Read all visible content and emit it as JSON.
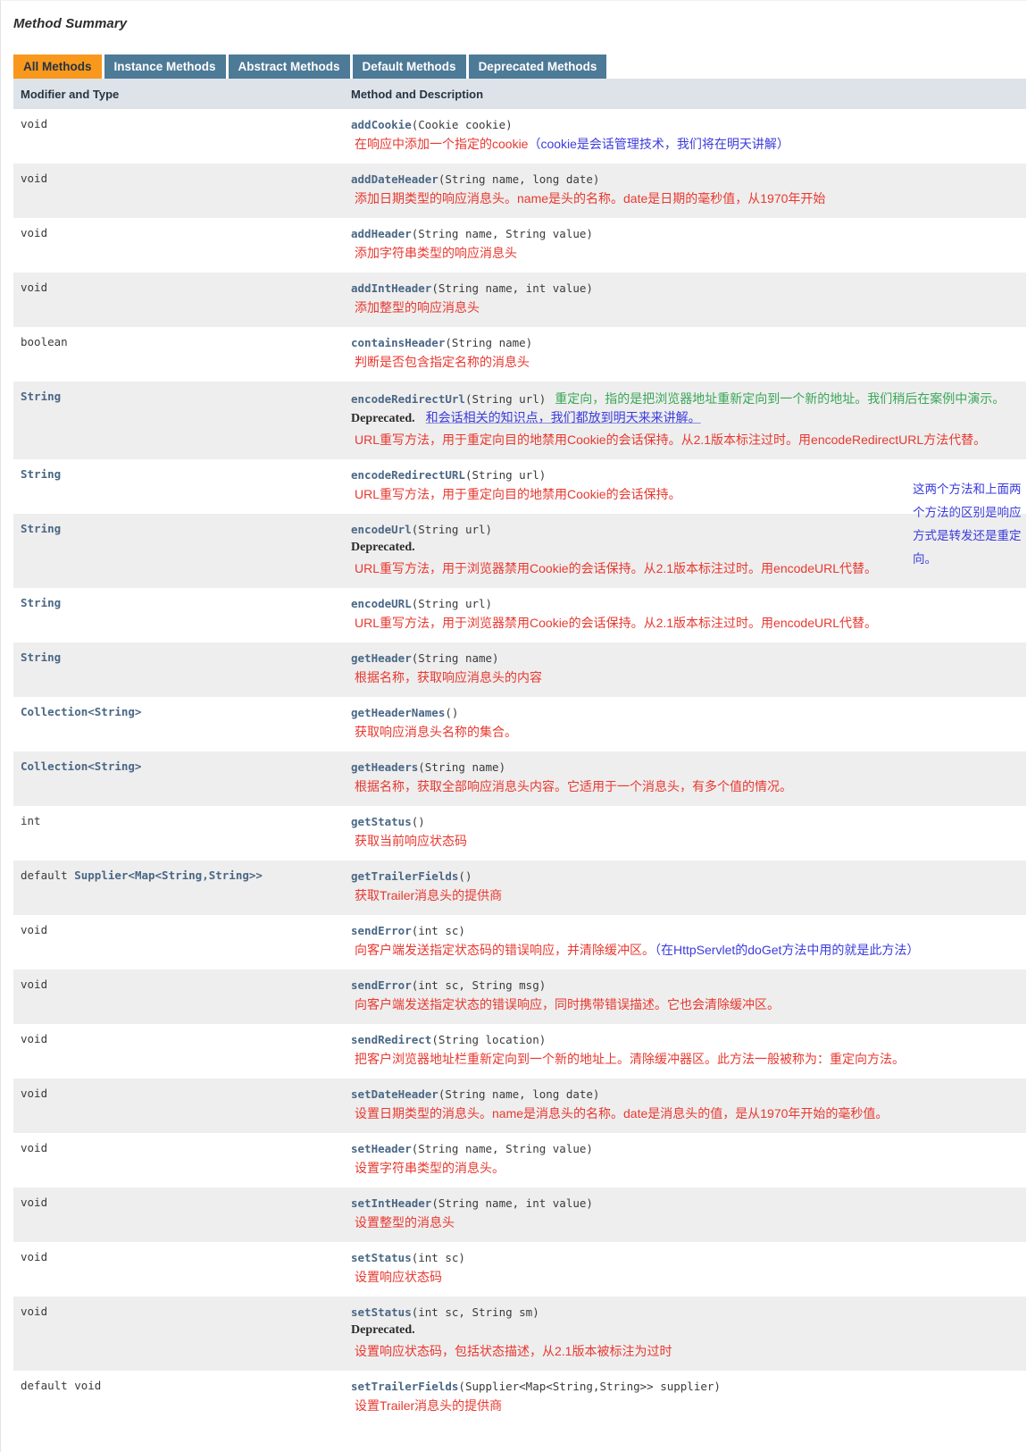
{
  "section": {
    "title": "Method Summary"
  },
  "tabs": [
    {
      "label": "All Methods",
      "active": true
    },
    {
      "label": "Instance Methods",
      "active": false
    },
    {
      "label": "Abstract Methods",
      "active": false
    },
    {
      "label": "Default Methods",
      "active": false
    },
    {
      "label": "Deprecated Methods",
      "active": false
    }
  ],
  "columns": {
    "modifier": "Modifier and Type",
    "method": "Method and Description"
  },
  "side_note": {
    "text": "这两个方法和上面两个方法的区别是响应方式是转发还是重定向。"
  },
  "colors": {
    "tab_active": "#f8981d",
    "tab_inactive": "#4d7a97",
    "header_bg": "#dee3e9",
    "row_alt_bg": "#eeeeee",
    "link": "#4a6785",
    "note_red": "#e8382f",
    "note_blue": "#3b3bdd",
    "note_green": "#3aa757"
  },
  "rows": [
    {
      "modifier": "void",
      "modifier_link": "",
      "name": "addCookie",
      "params": "(Cookie  cookie)",
      "deprecated": "",
      "inline_note": "",
      "notes": [
        {
          "style": "red",
          "text": "在响应中添加一个指定的cookie",
          "tail_blue": "（cookie是会话管理技术，我们将在明天讲解）"
        }
      ]
    },
    {
      "modifier": "void",
      "modifier_link": "",
      "name": "addDateHeader",
      "params": "(String  name, long  date)",
      "deprecated": "",
      "inline_note": "",
      "notes": [
        {
          "style": "red",
          "text": "添加日期类型的响应消息头。name是头的名称。date是日期的毫秒值，从1970年开始",
          "tail_blue": ""
        }
      ]
    },
    {
      "modifier": "void",
      "modifier_link": "",
      "name": "addHeader",
      "params": "(String  name, String  value)",
      "deprecated": "",
      "inline_note": "",
      "notes": [
        {
          "style": "red",
          "text": "添加字符串类型的响应消息头",
          "tail_blue": ""
        }
      ]
    },
    {
      "modifier": "void",
      "modifier_link": "",
      "name": "addIntHeader",
      "params": "(String  name, int  value)",
      "deprecated": "",
      "inline_note": "",
      "notes": [
        {
          "style": "red",
          "text": "添加整型的响应消息头",
          "tail_blue": ""
        }
      ]
    },
    {
      "modifier": "boolean",
      "modifier_link": "",
      "name": "containsHeader",
      "params": "(String  name)",
      "deprecated": "",
      "inline_note": "",
      "notes": [
        {
          "style": "red",
          "text": "判断是否包含指定名称的消息头",
          "tail_blue": ""
        }
      ]
    },
    {
      "modifier": "",
      "modifier_link": "String",
      "name": "encodeRedirectUrl",
      "params": "(String  url)",
      "deprecated": "Deprecated.",
      "inline_note": "重定向，指的是把浏览器地址重新定向到一个新的地址。我们稍后在案例中演示。",
      "deprecated_note": "和会话相关的知识点，我们都放到明天来来讲解。",
      "notes": [
        {
          "style": "red",
          "text": "URL重写方法，用于重定向目的地禁用Cookie的会话保持。从2.1版本标注过时。用encodeRedirectURL方法代替。",
          "tail_blue": ""
        }
      ]
    },
    {
      "modifier": "",
      "modifier_link": "String",
      "name": "encodeRedirectURL",
      "params": "(String  url)",
      "deprecated": "",
      "inline_note": "",
      "notes": [
        {
          "style": "red",
          "text": "URL重写方法，用于重定向目的地禁用Cookie的会话保持。",
          "tail_blue": ""
        }
      ]
    },
    {
      "modifier": "",
      "modifier_link": "String",
      "name": "encodeUrl",
      "params": "(String  url)",
      "deprecated": "Deprecated.",
      "inline_note": "",
      "notes": [
        {
          "style": "red",
          "text": "URL重写方法，用于浏览器禁用Cookie的会话保持。从2.1版本标注过时。用encodeURL代替。",
          "tail_blue": ""
        }
      ]
    },
    {
      "modifier": "",
      "modifier_link": "String",
      "name": "encodeURL",
      "params": "(String  url)",
      "deprecated": "",
      "inline_note": "",
      "notes": [
        {
          "style": "red",
          "text": "URL重写方法，用于浏览器禁用Cookie的会话保持。从2.1版本标注过时。用encodeURL代替。",
          "tail_blue": ""
        }
      ]
    },
    {
      "modifier": "",
      "modifier_link": "String",
      "name": "getHeader",
      "params": "(String  name)",
      "deprecated": "",
      "inline_note": "",
      "notes": [
        {
          "style": "red",
          "text": "根据名称，获取响应消息头的内容",
          "tail_blue": ""
        }
      ]
    },
    {
      "modifier": "",
      "modifier_link": "Collection<String>",
      "name": "getHeaderNames",
      "params": "()",
      "deprecated": "",
      "inline_note": "",
      "notes": [
        {
          "style": "red",
          "text": "获取响应消息头名称的集合。",
          "tail_blue": ""
        }
      ]
    },
    {
      "modifier": "",
      "modifier_link": "Collection<String>",
      "name": "getHeaders",
      "params": "(String  name)",
      "deprecated": "",
      "inline_note": "",
      "notes": [
        {
          "style": "red",
          "text": "根据名称，获取全部响应消息头内容。它适用于一个消息头，有多个值的情况。",
          "tail_blue": ""
        }
      ]
    },
    {
      "modifier": "int",
      "modifier_link": "",
      "name": "getStatus",
      "params": "()",
      "deprecated": "",
      "inline_note": "",
      "notes": [
        {
          "style": "red",
          "text": "获取当前响应状态码",
          "tail_blue": ""
        }
      ]
    },
    {
      "modifier": "default ",
      "modifier_link": "Supplier<Map<String,String>>",
      "name": "getTrailerFields",
      "params": "()",
      "deprecated": "",
      "inline_note": "",
      "notes": [
        {
          "style": "red",
          "text": "获取Trailer消息头的提供商",
          "tail_blue": ""
        }
      ]
    },
    {
      "modifier": "void",
      "modifier_link": "",
      "name": "sendError",
      "params": "(int  sc)",
      "deprecated": "",
      "inline_note": "",
      "notes": [
        {
          "style": "red",
          "text": "向客户端发送指定状态码的错误响应，并清除缓冲区。",
          "tail_blue": "（在HttpServlet的doGet方法中用的就是此方法）"
        }
      ]
    },
    {
      "modifier": "void",
      "modifier_link": "",
      "name": "sendError",
      "params": "(int  sc, String  msg)",
      "deprecated": "",
      "inline_note": "",
      "notes": [
        {
          "style": "red",
          "text": "向客户端发送指定状态的错误响应，同时携带错误描述。它也会清除缓冲区。",
          "tail_blue": ""
        }
      ]
    },
    {
      "modifier": "void",
      "modifier_link": "",
      "name": "sendRedirect",
      "params": "(String  location)",
      "deprecated": "",
      "inline_note": "",
      "notes": [
        {
          "style": "red",
          "text": "把客户浏览器地址栏重新定向到一个新的地址上。清除缓冲器区。此方法一般被称为：重定向方法。",
          "tail_blue": ""
        }
      ]
    },
    {
      "modifier": "void",
      "modifier_link": "",
      "name": "setDateHeader",
      "params": "(String  name, long  date)",
      "deprecated": "",
      "inline_note": "",
      "notes": [
        {
          "style": "red",
          "text": "设置日期类型的消息头。name是消息头的名称。date是消息头的值，是从1970年开始的毫秒值。",
          "tail_blue": ""
        }
      ]
    },
    {
      "modifier": "void",
      "modifier_link": "",
      "name": "setHeader",
      "params": "(String  name, String  value)",
      "deprecated": "",
      "inline_note": "",
      "notes": [
        {
          "style": "red",
          "text": "设置字符串类型的消息头。",
          "tail_blue": ""
        }
      ]
    },
    {
      "modifier": "void",
      "modifier_link": "",
      "name": "setIntHeader",
      "params": "(String  name, int  value)",
      "deprecated": "",
      "inline_note": "",
      "notes": [
        {
          "style": "red",
          "text": "设置整型的消息头",
          "tail_blue": ""
        }
      ]
    },
    {
      "modifier": "void",
      "modifier_link": "",
      "name": "setStatus",
      "params": "(int  sc)",
      "deprecated": "",
      "inline_note": "",
      "notes": [
        {
          "style": "red",
          "text": "设置响应状态码",
          "tail_blue": ""
        }
      ]
    },
    {
      "modifier": "void",
      "modifier_link": "",
      "name": "setStatus",
      "params": "(int  sc, String  sm)",
      "deprecated": "Deprecated.",
      "inline_note": "",
      "notes": [
        {
          "style": "red",
          "text": "设置响应状态码，包括状态描述，从2.1版本被标注为过时",
          "tail_blue": ""
        }
      ]
    },
    {
      "modifier": "default void",
      "modifier_link": "",
      "name": "setTrailerFields",
      "params": "(Supplier<Map<String,String>>  supplier)",
      "deprecated": "",
      "inline_note": "",
      "notes": [
        {
          "style": "red",
          "text": "设置Trailer消息头的提供商",
          "tail_blue": ""
        }
      ]
    }
  ]
}
